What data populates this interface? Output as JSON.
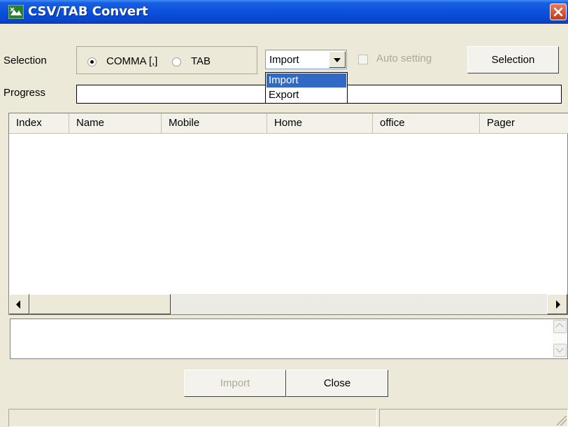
{
  "window": {
    "title": "CSV/TAB  Convert"
  },
  "controls": {
    "selection_label": "Selection",
    "progress_label": "Progress",
    "radio_comma": "COMMA [,]",
    "radio_tab": "TAB",
    "selected_radio": "COMMA [,]",
    "mode_value": "Import",
    "mode_options": [
      "Import",
      "Export"
    ],
    "auto_setting_label": "Auto setting",
    "selection_button": "Selection"
  },
  "table": {
    "columns": [
      "Index",
      "Name",
      "Mobile",
      "Home",
      "office",
      "Pager"
    ],
    "rows": []
  },
  "buttons": {
    "import": "Import",
    "close": "Close"
  },
  "colors": {
    "titlebar": "#0a50dc",
    "selection_highlight": "#316ac5",
    "window_bg": "#ece9d8"
  }
}
